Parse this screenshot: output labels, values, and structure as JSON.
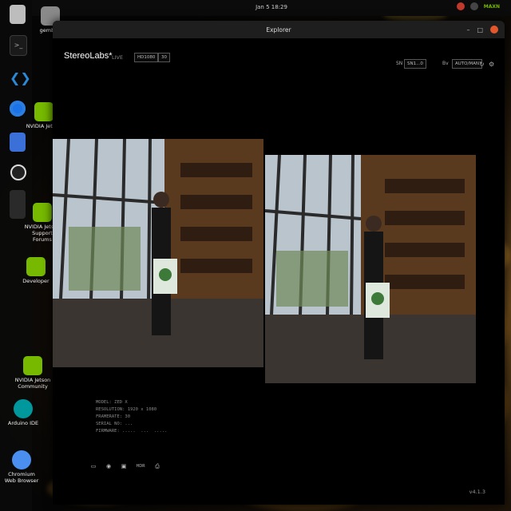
{
  "topbar": {
    "clock": "Jan 5  18:29",
    "tray_label": "MAXN"
  },
  "desktop": {
    "icons": [
      {
        "label": "gembod",
        "color": "#8a8a8a"
      },
      {
        "label": "NVIDIA Jetson",
        "color": "#76b900"
      },
      {
        "label": "NVIDIA Jetson Support Forums",
        "color": "#76b900"
      },
      {
        "label": "Developer",
        "color": "#76b900"
      },
      {
        "label": "NVIDIA Jetson Community",
        "color": "#76b900"
      },
      {
        "label": "Arduino IDE",
        "color": "#00979d"
      },
      {
        "label": "Chromium Web Browser",
        "color": "#4a8ff0"
      }
    ]
  },
  "window": {
    "title": "Explorer",
    "brand": "StereoLabs*",
    "live": "LIVE",
    "resolution": "HD1080",
    "fps": "30",
    "right_label_1": "SN",
    "right_select_1": "SN1...0",
    "right_label_2": "Bv",
    "right_select_2": "AUTO/MAN",
    "info_lines": [
      "MODEL: ZED X",
      "RESOLUTION: 1920 x 1080",
      "FRAMERATE: 30",
      "SERIAL NO: ...",
      "FIRMWARE: .....  ...  ....."
    ],
    "toolbar_hd": "HDR",
    "version": "v4.1.3"
  }
}
